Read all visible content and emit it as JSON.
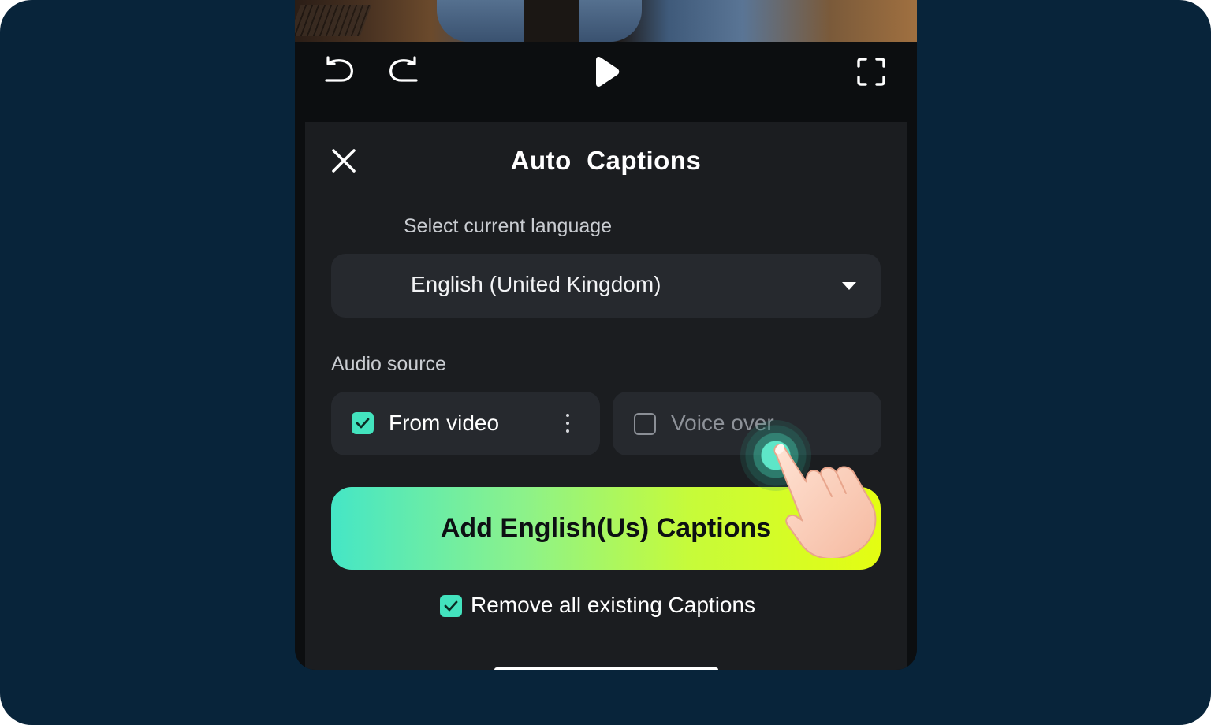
{
  "toolbar": {
    "undo_icon": "undo-icon",
    "redo_icon": "redo-icon",
    "play_icon": "play-icon",
    "fullscreen_icon": "fullscreen-icon"
  },
  "panel": {
    "title": "Auto  Captions",
    "close_icon": "close-icon",
    "language_label": "Select current language",
    "language_value": "English (United Kingdom)",
    "audio_source_label": "Audio source",
    "audio_options": [
      {
        "label": "From video",
        "checked": true
      },
      {
        "label": "Voice over",
        "checked": false
      }
    ],
    "add_button_label": "Add English(Us) Captions",
    "remove_existing_label": "Remove all existing Captions",
    "remove_existing_checked": true
  },
  "colors": {
    "background": "#08243a",
    "panel": "#1b1d20",
    "field": "#26292e",
    "accent": "#43e3be",
    "button_gradient_start": "#45e6c6",
    "button_gradient_end": "#e4fd12"
  }
}
